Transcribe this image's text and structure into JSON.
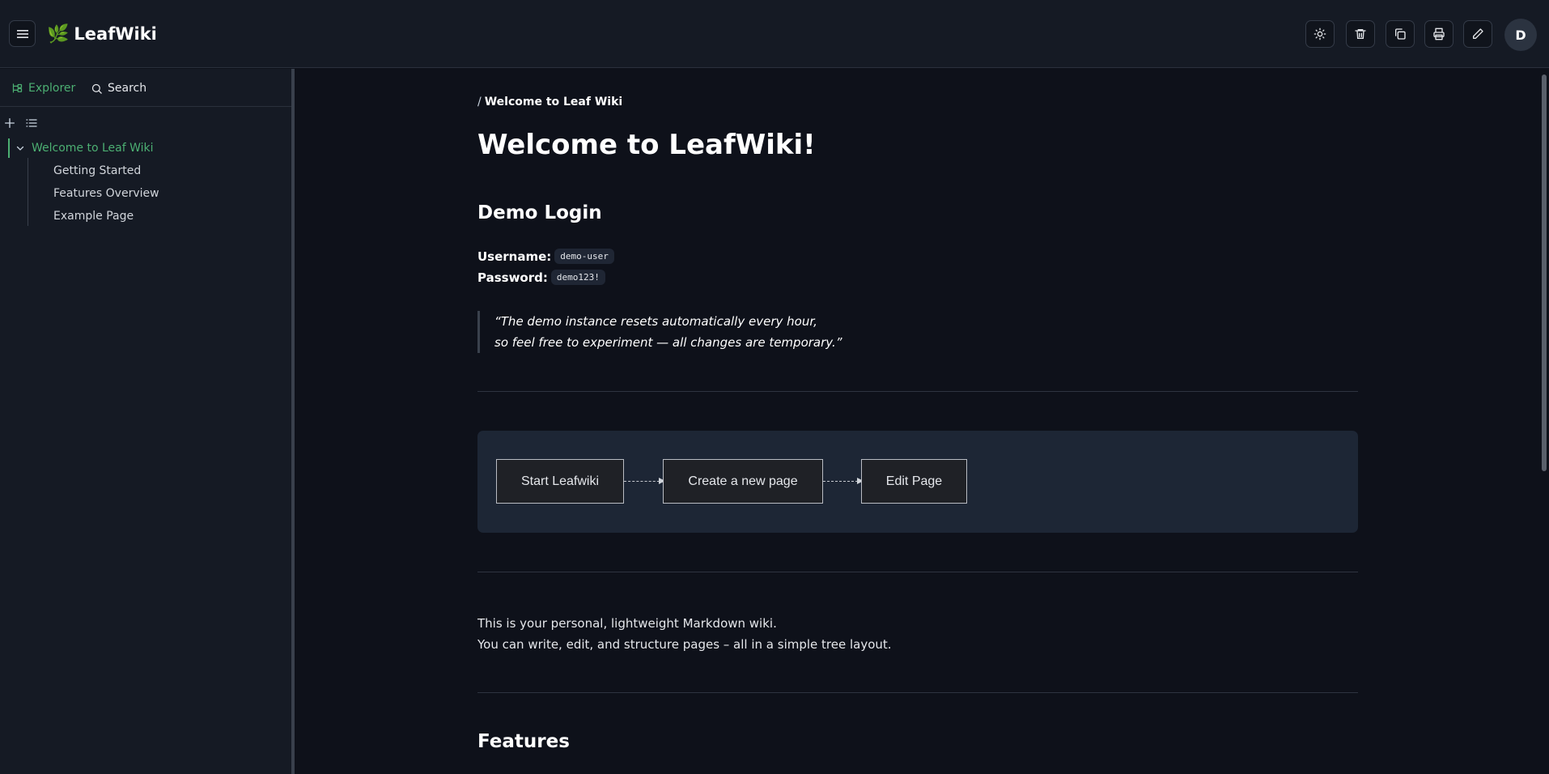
{
  "header": {
    "brand_icon": "leaf-icon",
    "brand_name": "LeafWiki",
    "avatar_initial": "D",
    "actions": [
      "theme-toggle",
      "delete",
      "copy",
      "print",
      "edit"
    ]
  },
  "sidebar": {
    "tabs": [
      {
        "label": "Explorer",
        "icon": "tree-icon",
        "active": true
      },
      {
        "label": "Search",
        "icon": "search-icon",
        "active": false
      }
    ],
    "tree": {
      "root": "Welcome to Leaf Wiki",
      "children": [
        "Getting Started",
        "Features Overview",
        "Example Page"
      ]
    }
  },
  "page": {
    "breadcrumb_sep": "/",
    "breadcrumb_current": "Welcome to Leaf Wiki",
    "title": "Welcome to LeafWiki!",
    "demo_heading": "Demo Login",
    "username_label": "Username:",
    "username_value": "demo-user",
    "password_label": "Password:",
    "password_value": "demo123!",
    "quote_line1": "“The demo instance resets automatically every hour,",
    "quote_line2": "so feel free to experiment — all changes are temporary.”",
    "flow": [
      "Start Leafwiki",
      "Create a new page",
      "Edit Page"
    ],
    "intro_line1": "This is your personal, lightweight Markdown wiki.",
    "intro_line2": "You can write, edit, and structure pages – all in a simple tree layout.",
    "features_heading": "Features"
  },
  "colors": {
    "accent": "#4caf72",
    "background": "#0e111a",
    "panel": "#151a24",
    "diagram_bg": "#1d2635"
  }
}
